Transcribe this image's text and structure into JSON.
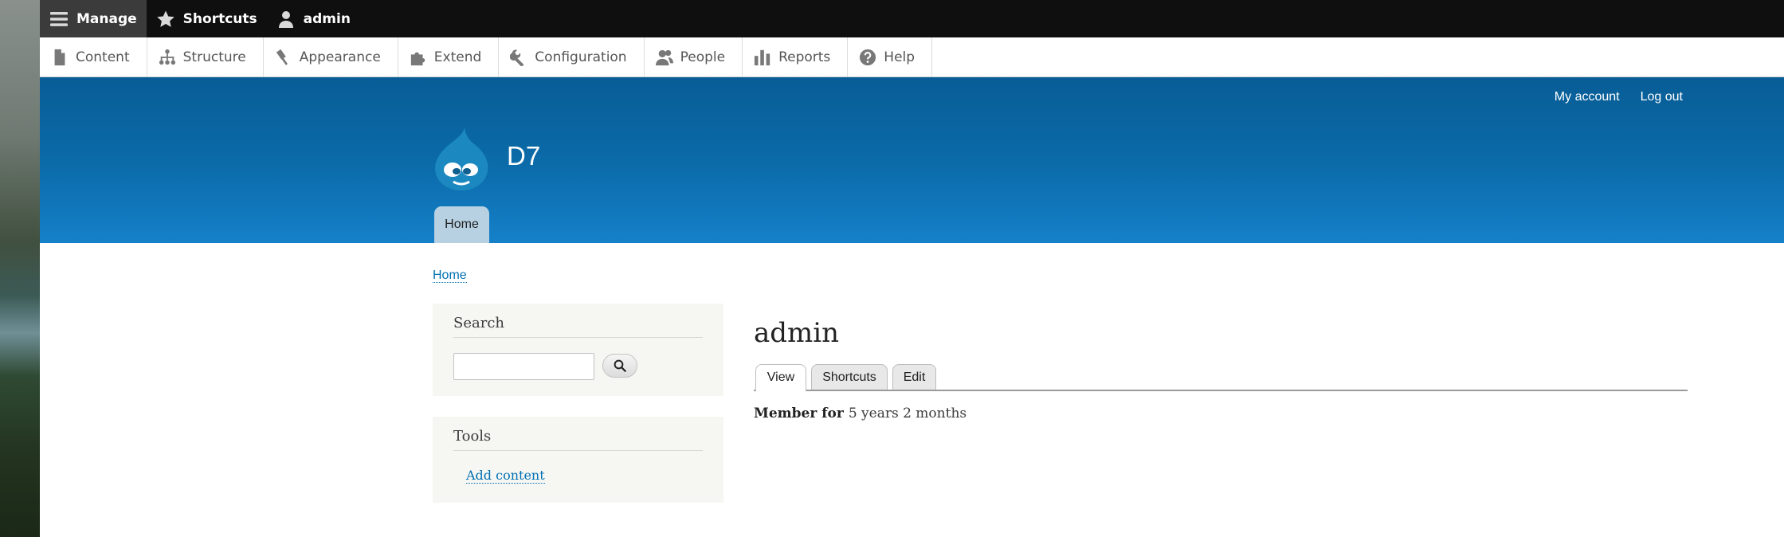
{
  "toolbar": {
    "manage": {
      "label": "Manage",
      "icon": "hamburger-icon"
    },
    "shortcuts": {
      "label": "Shortcuts",
      "icon": "star-icon"
    },
    "user": {
      "label": "admin",
      "icon": "user-icon"
    }
  },
  "tray": {
    "items": [
      {
        "label": "Content",
        "icon": "file-icon"
      },
      {
        "label": "Structure",
        "icon": "sitemap-icon"
      },
      {
        "label": "Appearance",
        "icon": "paint-roller-icon"
      },
      {
        "label": "Extend",
        "icon": "puzzle-icon"
      },
      {
        "label": "Configuration",
        "icon": "wrench-icon"
      },
      {
        "label": "People",
        "icon": "people-icon"
      },
      {
        "label": "Reports",
        "icon": "bar-chart-icon"
      },
      {
        "label": "Help",
        "icon": "help-icon"
      }
    ]
  },
  "header": {
    "secondary_menu": {
      "my_account": "My account",
      "log_out": "Log out"
    },
    "site_name": "D7",
    "home_tab": "Home",
    "brand_color": "#0b6aa8"
  },
  "breadcrumb": {
    "home": "Home"
  },
  "sidebar": {
    "search": {
      "title": "Search",
      "input_value": "",
      "button_icon": "search-icon"
    },
    "tools": {
      "title": "Tools",
      "link": "Add content"
    }
  },
  "main": {
    "title": "admin",
    "tabs": [
      {
        "label": "View",
        "active": true
      },
      {
        "label": "Shortcuts"
      },
      {
        "label": "Edit"
      }
    ],
    "member_for_label": "Member for",
    "member_for_value": "5 years 2 months"
  }
}
